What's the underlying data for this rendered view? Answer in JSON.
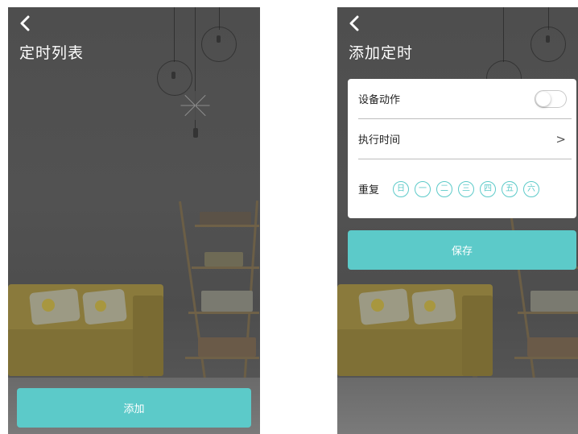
{
  "colors": {
    "accent": "#5ccac9",
    "card_bg": "#ffffff",
    "title_text": "#ffffff"
  },
  "left_screen": {
    "back_icon": "chevron-left-icon",
    "title": "定时列表",
    "add_button_label": "添加"
  },
  "right_screen": {
    "back_icon": "chevron-left-icon",
    "title": "添加定时",
    "card": {
      "device_action_label": "设备动作",
      "device_action_toggle_on": false,
      "execute_time_label": "执行时间",
      "execute_time_icon": "chevron-right-icon",
      "chevron_glyph": ">",
      "repeat_label": "重复",
      "days": [
        "日",
        "一",
        "二",
        "三",
        "四",
        "五",
        "六"
      ]
    },
    "save_button_label": "保存"
  }
}
